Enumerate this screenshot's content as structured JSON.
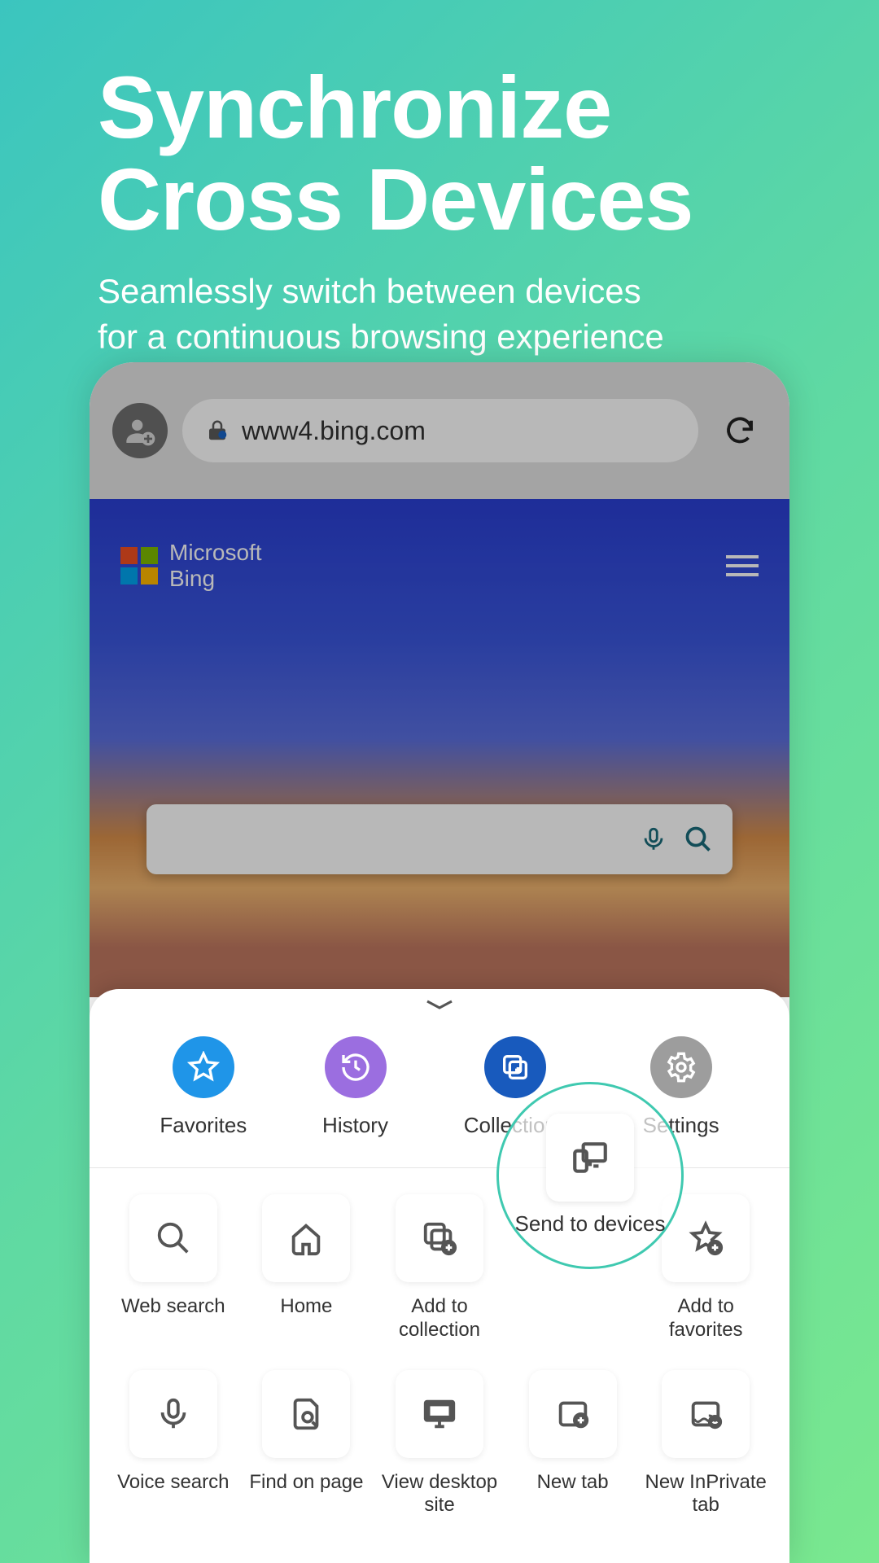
{
  "promo": {
    "title_line1": "Synchronize",
    "title_line2": "Cross Devices",
    "subtitle_line1": "Seamlessly switch between devices",
    "subtitle_line2": "for a continuous browsing experience"
  },
  "browser": {
    "url": "www4.bing.com"
  },
  "bing": {
    "brand_line1": "Microsoft",
    "brand_line2": "Bing"
  },
  "sheet": {
    "top": [
      {
        "label": "Favorites",
        "color": "#1f95e8"
      },
      {
        "label": "History",
        "color": "#9b6ee0"
      },
      {
        "label": "Collections",
        "color": "#185abd"
      },
      {
        "label": "Settings",
        "color": "#9d9d9d"
      }
    ],
    "grid_row1": [
      {
        "label": "Web search"
      },
      {
        "label": "Home"
      },
      {
        "label": "Add to collection"
      },
      {
        "label": "Send to devices"
      },
      {
        "label": "Add to favorites"
      }
    ],
    "grid_row2": [
      {
        "label": "Voice search"
      },
      {
        "label": "Find on page"
      },
      {
        "label": "View desktop site"
      },
      {
        "label": "New tab"
      },
      {
        "label": "New InPrivate tab"
      }
    ]
  },
  "highlight": {
    "label": "Send to devices"
  }
}
